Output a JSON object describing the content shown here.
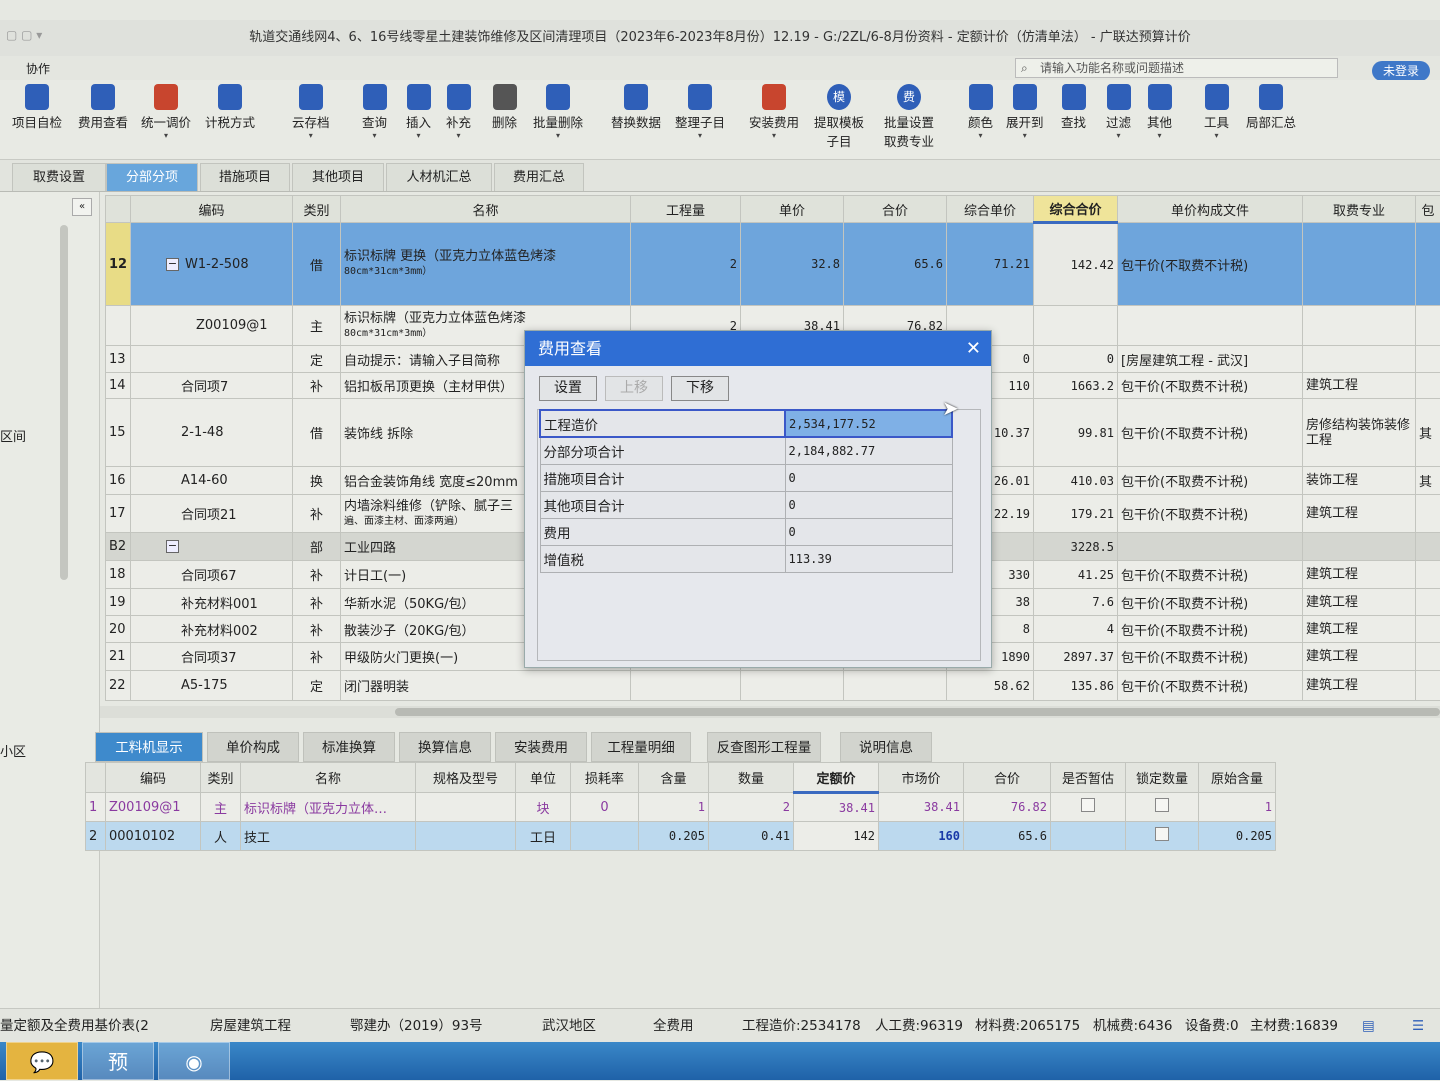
{
  "window": {
    "title": "轨道交通线网4、6、16号线零星土建装饰维修及区间清理项目（2023年6-2023年8月份）12.19 - G:/2ZL/6-8月份资料 - 定额计价（仿清单法） - 广联达预算计价"
  },
  "menu": {
    "collab": "协作",
    "search_placeholder": "请输入功能名称或问题描述",
    "login": "未登录"
  },
  "toolbar": [
    {
      "label": "项目自检",
      "icon": "check-icon"
    },
    {
      "label": "费用查看",
      "icon": "fee-view-icon"
    },
    {
      "label": "统一调价",
      "icon": "adjust-price-icon",
      "dropdown": true
    },
    {
      "label": "计税方式",
      "icon": "tax-mode-icon"
    },
    {
      "label": "云存档",
      "icon": "cloud-upload-icon",
      "dropdown": true
    },
    {
      "label": "查询",
      "icon": "query-icon",
      "dropdown": true
    },
    {
      "label": "插入",
      "icon": "insert-icon",
      "dropdown": true
    },
    {
      "label": "补充",
      "icon": "supplement-icon",
      "dropdown": true
    },
    {
      "label": "删除",
      "icon": "trash-icon"
    },
    {
      "label": "批量删除",
      "icon": "batch-delete-icon",
      "dropdown": true
    },
    {
      "label": "替换数据",
      "icon": "replace-icon"
    },
    {
      "label": "整理子目",
      "icon": "organize-icon",
      "dropdown": true
    },
    {
      "label": "安装费用",
      "icon": "install-fee-icon",
      "dropdown": true
    },
    {
      "label": "提取模板",
      "label2": "子目",
      "icon": "template-icon",
      "glyph": "模"
    },
    {
      "label": "批量设置",
      "label2": "取费专业",
      "icon": "fee-icon",
      "glyph": "费"
    },
    {
      "label": "颜色",
      "icon": "color-icon",
      "dropdown": true
    },
    {
      "label": "展开到",
      "icon": "expand-icon",
      "dropdown": true
    },
    {
      "label": "查找",
      "icon": "find-icon"
    },
    {
      "label": "过滤",
      "icon": "filter-icon",
      "dropdown": true
    },
    {
      "label": "其他",
      "icon": "other-icon",
      "dropdown": true
    },
    {
      "label": "工具",
      "icon": "tools-icon",
      "dropdown": true
    },
    {
      "label": "局部汇总",
      "icon": "summary-icon"
    }
  ],
  "tabs": [
    "取费设置",
    "分部分项",
    "措施项目",
    "其他项目",
    "人材机汇总",
    "费用汇总"
  ],
  "active_tab": "分部分项",
  "left_panel": {
    "item1": "区间",
    "item2": "小区"
  },
  "grid": {
    "columns": [
      "",
      "编码",
      "类别",
      "名称",
      "工程量",
      "单价",
      "合价",
      "综合单价",
      "综合合价",
      "单价构成文件",
      "取费专业",
      "包"
    ],
    "rows": [
      {
        "no": "12",
        "code": "W1-2-508",
        "type": "借",
        "name": "标识标牌 更换（亚克力立体蓝色烤漆",
        "name2": "80cm*31cm*3mm）",
        "qty": "2",
        "price": "32.8",
        "total": "65.6",
        "cunit": "71.21",
        "ctotal": "142.42",
        "file": "包干价(不取费不计税)",
        "prof": "",
        "extra": "",
        "selected": true,
        "expand": true
      },
      {
        "no": "",
        "code": "Z00109@1",
        "type": "主",
        "name": "标识标牌（亚克力立体蓝色烤漆",
        "name2": "80cm*31cm*3mm）",
        "qty": "2",
        "price": "38.41",
        "total": "76.82",
        "cunit": "",
        "ctotal": "",
        "file": "",
        "prof": "",
        "extra": ""
      },
      {
        "no": "13",
        "code": "",
        "type": "定",
        "name": "自动提示：请输入子目简称",
        "cunit": "0",
        "ctotal": "0",
        "file": "[房屋建筑工程 - 武汉]",
        "prof": "",
        "extra": ""
      },
      {
        "no": "14",
        "code": "合同项7",
        "type": "补",
        "name": "铝扣板吊顶更换（主材甲供）",
        "cunit": "110",
        "ctotal": "1663.2",
        "file": "包干价(不取费不计税)",
        "prof": "建筑工程",
        "extra": ""
      },
      {
        "no": "15",
        "code": "2-1-48",
        "type": "借",
        "name": "装饰线 拆除",
        "cunit": "10.37",
        "ctotal": "99.81",
        "file": "包干价(不取费不计税)",
        "prof": "房修结构装饰装修工程",
        "extra": "其"
      },
      {
        "no": "16",
        "code": "A14-60",
        "type": "换",
        "name": "铝合金装饰角线 宽度≤20mm",
        "cunit": "26.01",
        "ctotal": "410.03",
        "file": "包干价(不取费不计税)",
        "prof": "装饰工程",
        "extra": "其"
      },
      {
        "no": "17",
        "code": "合同项21",
        "type": "补",
        "name": "内墙涂料维修（铲除、腻子三",
        "name2": "遍、面漆主材、面漆两遍）",
        "cunit": "22.19",
        "ctotal": "179.21",
        "file": "包干价(不取费不计税)",
        "prof": "建筑工程",
        "extra": ""
      },
      {
        "no": "B2",
        "code": "",
        "type": "部",
        "name": "工业四路",
        "cunit": "",
        "ctotal": "3228.5",
        "file": "",
        "prof": "",
        "extra": "",
        "part": true,
        "expand": true
      },
      {
        "no": "18",
        "code": "合同项67",
        "type": "补",
        "name": "计日工(一)",
        "cunit": "330",
        "ctotal": "41.25",
        "file": "包干价(不取费不计税)",
        "prof": "建筑工程",
        "extra": ""
      },
      {
        "no": "19",
        "code": "补充材料001",
        "type": "补",
        "name": "华新水泥（50KG/包）",
        "cunit": "38",
        "ctotal": "7.6",
        "file": "包干价(不取费不计税)",
        "prof": "建筑工程",
        "extra": ""
      },
      {
        "no": "20",
        "code": "补充材料002",
        "type": "补",
        "name": "散装沙子（20KG/包）",
        "cunit": "8",
        "ctotal": "4",
        "file": "包干价(不取费不计税)",
        "prof": "建筑工程",
        "extra": ""
      },
      {
        "no": "21",
        "code": "合同项37",
        "type": "补",
        "name": "甲级防火门更换(一)",
        "cunit": "1890",
        "ctotal": "2897.37",
        "file": "包干价(不取费不计税)",
        "prof": "建筑工程",
        "extra": ""
      },
      {
        "no": "22",
        "code": "A5-175",
        "type": "定",
        "name": "闭门器明装",
        "cunit": "58.62",
        "ctotal": "135.86",
        "file": "包干价(不取费不计税)",
        "prof": "建筑工程",
        "extra": ""
      }
    ]
  },
  "bottom_tabs": [
    "工料机显示",
    "单价构成",
    "标准换算",
    "换算信息",
    "安装费用",
    "工程量明细",
    "反查图形工程量",
    "说明信息"
  ],
  "bottom_grid": {
    "columns": [
      "",
      "编码",
      "类别",
      "名称",
      "规格及型号",
      "单位",
      "损耗率",
      "含量",
      "数量",
      "定额价",
      "市场价",
      "合价",
      "是否暂估",
      "锁定数量",
      "原始含量"
    ],
    "rows": [
      {
        "no": "1",
        "code": "Z00109@1",
        "type": "主",
        "name": "标识标牌（亚克力立体…",
        "spec": "",
        "unit": "块",
        "loss": "0",
        "content": "1",
        "qty": "2",
        "quota": "38.41",
        "market": "38.41",
        "total": "76.82",
        "est": false,
        "lock": false,
        "orig": "1"
      },
      {
        "no": "2",
        "code": "00010102",
        "type": "人",
        "name": "技工",
        "spec": "",
        "unit": "工日",
        "loss": "",
        "content": "0.205",
        "qty": "0.41",
        "quota": "142",
        "market": "160",
        "total": "65.6",
        "est": null,
        "lock": false,
        "orig": "0.205"
      }
    ]
  },
  "status": {
    "s1": "量定额及全费用基价表(2",
    "s2": "房屋建筑工程",
    "s3": "鄂建办（2019）93号",
    "s4": "武汉地区",
    "s5": "全费用",
    "s6": "工程造价:2534178",
    "s7": "人工费:96319",
    "s8": "材料费:2065175",
    "s9": "机械费:6436",
    "s10": "设备费:0",
    "s11": "主材费:16839"
  },
  "taskbar": {
    "app2_glyph": "预"
  },
  "dialog": {
    "title": "费用查看",
    "buttons": {
      "settings": "设置",
      "up": "上移",
      "down": "下移"
    },
    "items": [
      {
        "label": "工程造价",
        "value": "2,534,177.52"
      },
      {
        "label": "分部分项合计",
        "value": "2,184,882.77"
      },
      {
        "label": "措施项目合计",
        "value": "0"
      },
      {
        "label": "其他项目合计",
        "value": "0"
      },
      {
        "label": "费用",
        "value": "0"
      },
      {
        "label": "增值税",
        "value": "113.39"
      }
    ]
  },
  "colors": {
    "accent": "#2f6ed4",
    "selected_row": "#6ea5dc",
    "highlight_header": "#efe49a"
  }
}
